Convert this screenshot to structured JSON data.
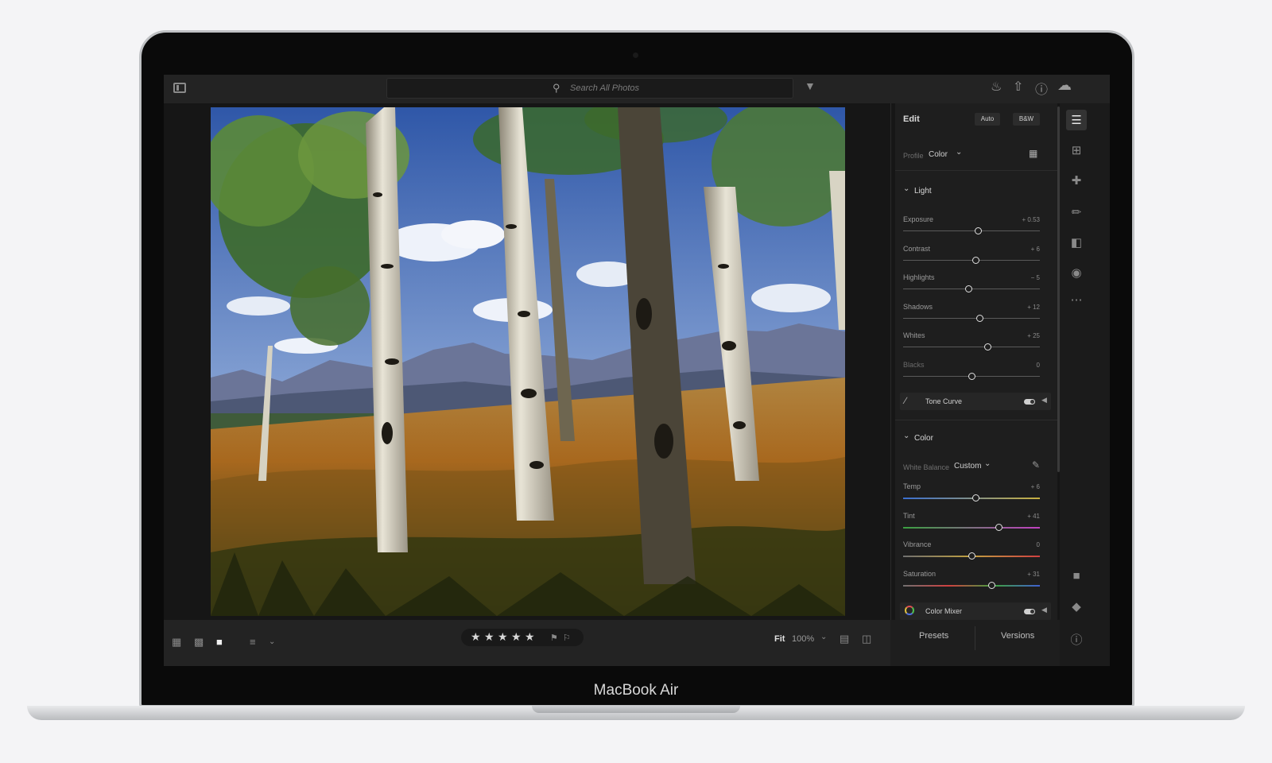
{
  "toolbar": {
    "search_placeholder": "Search All Photos"
  },
  "edit_panel": {
    "title": "Edit",
    "auto_label": "Auto",
    "bw_label": "B&W",
    "profile_label": "Profile",
    "profile_value": "Color",
    "light": {
      "title": "Light",
      "sliders": [
        {
          "label": "Exposure",
          "value": "+ 0.53",
          "level": 0.55
        },
        {
          "label": "Contrast",
          "value": "+ 6",
          "level": 0.53
        },
        {
          "label": "Highlights",
          "value": "− 5",
          "level": 0.48
        },
        {
          "label": "Shadows",
          "value": "+ 12",
          "level": 0.56
        },
        {
          "label": "Whites",
          "value": "+ 25",
          "level": 0.62
        },
        {
          "label": "Blacks",
          "value": "0",
          "level": 0.5
        }
      ],
      "tone_curve_label": "Tone Curve"
    },
    "color": {
      "title": "Color",
      "white_balance_label": "White Balance",
      "white_balance_value": "Custom",
      "sliders": [
        {
          "label": "Temp",
          "value": "+ 6",
          "level": 0.53
        },
        {
          "label": "Tint",
          "value": "+ 41",
          "level": 0.7
        },
        {
          "label": "Vibrance",
          "value": "0",
          "level": 0.5
        },
        {
          "label": "Saturation",
          "value": "+ 31",
          "level": 0.65
        }
      ],
      "color_mixer_label": "Color Mixer"
    }
  },
  "bottom": {
    "rating": 5,
    "fit_label": "Fit",
    "zoom_value": "100%",
    "presets_label": "Presets",
    "versions_label": "Versions"
  },
  "device": {
    "brand_label": "MacBook Air"
  },
  "colors": {
    "accent": "#e0e0e0",
    "panel_bg": "#1e1e1e"
  }
}
